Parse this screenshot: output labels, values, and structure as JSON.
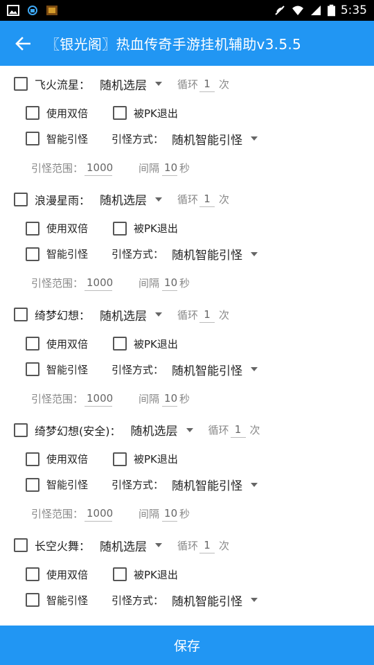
{
  "status": {
    "time": "5:35"
  },
  "appbar": {
    "title": "〖银光阁〗热血传奇手游挂机辅助v3.5.5"
  },
  "labels": {
    "loop_prefix": "循环",
    "loop_suffix": "次",
    "double": "使用双倍",
    "pk_exit": "被PK退出",
    "smart_lure": "智能引怪",
    "lure_mode": "引怪方式：",
    "lure_range": "引怪范围：",
    "interval": "间隔",
    "seconds": "秒"
  },
  "blocks": [
    {
      "skill": "飞火流星：",
      "select": "随机选层",
      "loop": "1",
      "lure_mode_value": "随机智能引怪",
      "range": "1000",
      "interval": "10"
    },
    {
      "skill": "浪漫星雨：",
      "select": "随机选层",
      "loop": "1",
      "lure_mode_value": "随机智能引怪",
      "range": "1000",
      "interval": "10"
    },
    {
      "skill": "绮梦幻想：",
      "select": "随机选层",
      "loop": "1",
      "lure_mode_value": "随机智能引怪",
      "range": "1000",
      "interval": "10"
    },
    {
      "skill": "绮梦幻想(安全)：",
      "select": "随机选层",
      "loop": "1",
      "lure_mode_value": "随机智能引怪",
      "range": "1000",
      "interval": "10"
    },
    {
      "skill": "长空火舞：",
      "select": "随机选层",
      "loop": "1",
      "lure_mode_value": "随机智能引怪"
    }
  ],
  "save_label": "保存",
  "colors": {
    "primary": "#2196f3",
    "statusbar": "#000000"
  }
}
